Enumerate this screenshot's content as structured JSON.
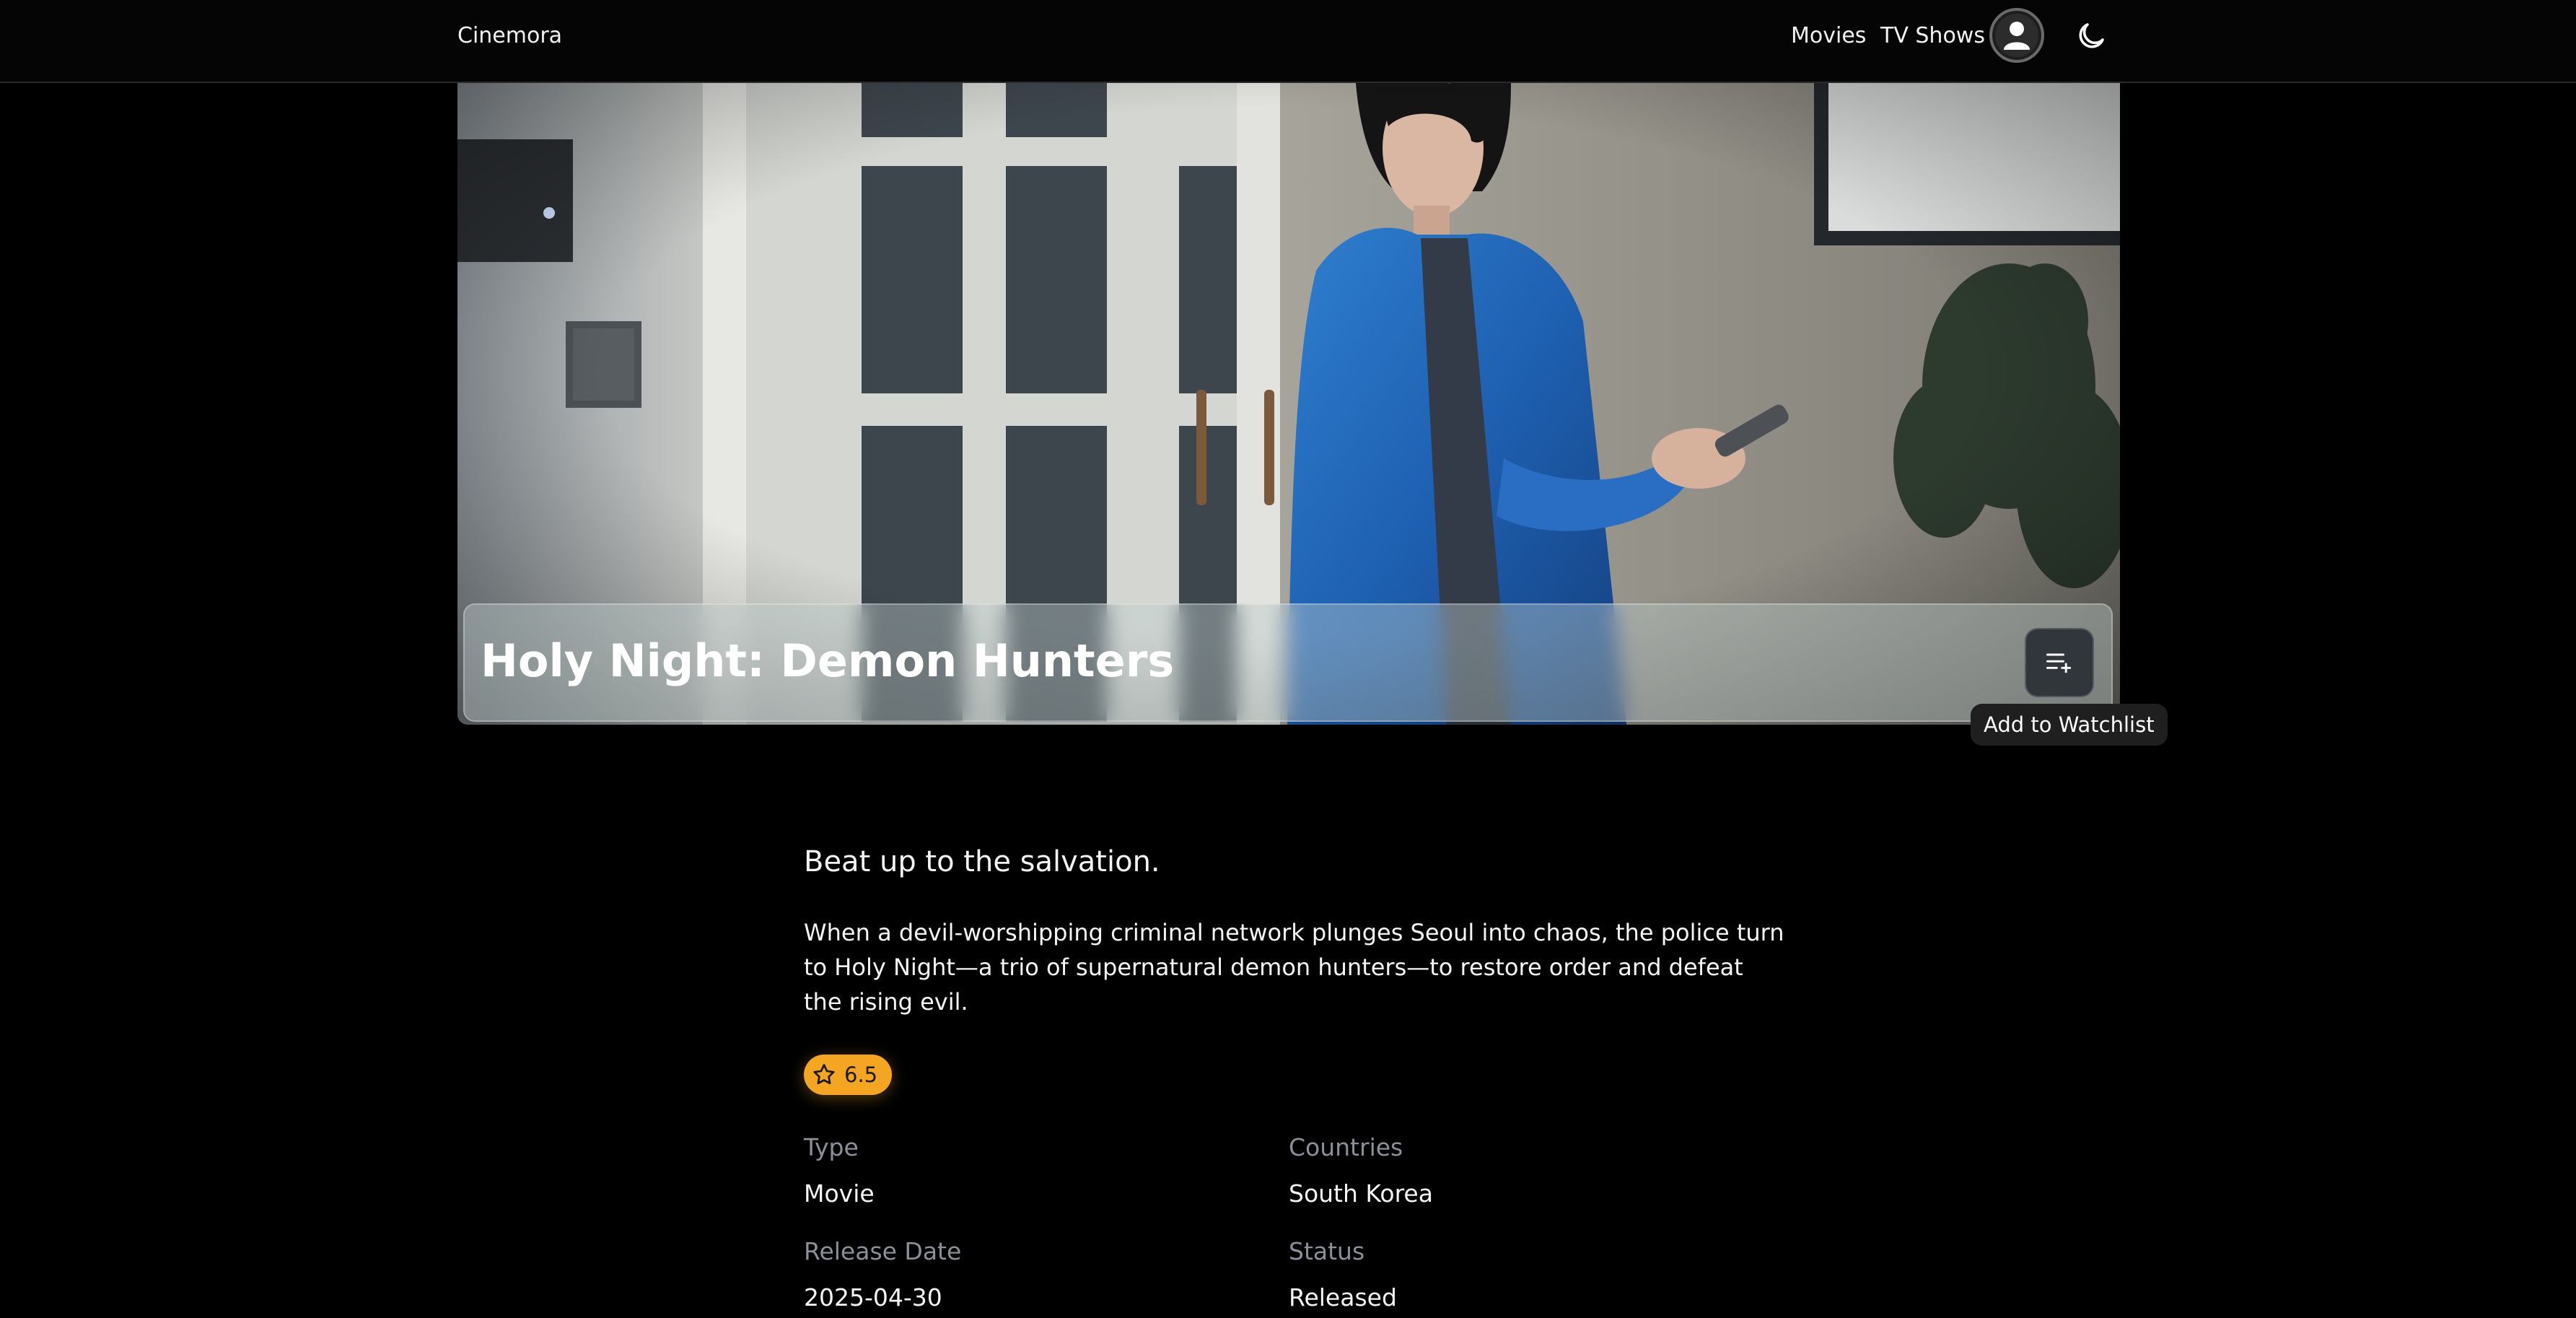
{
  "header": {
    "brand": "Cinemora",
    "nav": [
      "Movies",
      "TV Shows"
    ],
    "profile_icon": "user-avatar-icon",
    "theme_icon": "moon-icon"
  },
  "hero": {
    "title": "Holy Night: Demon Hunters",
    "watchlist_icon": "playlist-add-icon",
    "watchlist_tooltip": "Add to Watchlist"
  },
  "details": {
    "tagline": "Beat up to the salvation.",
    "overview": "When a devil-worshipping criminal network plunges Seoul into chaos, the police turn to Holy Night—a trio of supernatural demon hunters—to restore order and defeat the rising evil.",
    "rating": "6.5",
    "rating_icon": "star-icon",
    "rating_color": "#f4a623",
    "fields": [
      {
        "label": "Type",
        "value": "Movie"
      },
      {
        "label": "Countries",
        "value": "South Korea"
      },
      {
        "label": "Release Date",
        "value": "2025-04-30"
      },
      {
        "label": "Status",
        "value": "Released"
      }
    ]
  }
}
